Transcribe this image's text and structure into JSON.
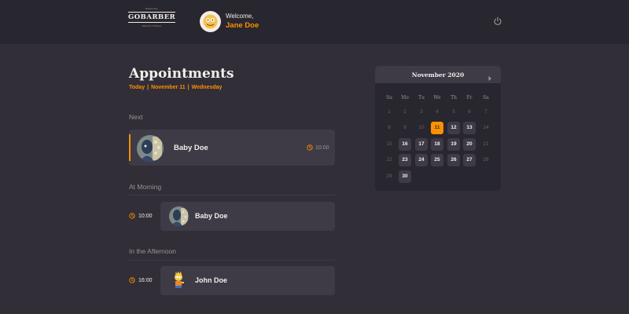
{
  "header": {
    "logo_top_text": "Barbershop",
    "logo_brand": "GOBARBER",
    "logo_bottom_text": "Haircuts & Shaves",
    "welcome_label": "Welcome,",
    "user_name": "Jane Doe"
  },
  "page": {
    "title": "Appointments",
    "date_today": "Today",
    "date_day": "November 11",
    "date_weekday": "Wednesday",
    "date_separator": "|"
  },
  "next": {
    "section_label": "Next",
    "name": "Baby Doe",
    "time": "10:00"
  },
  "morning": {
    "section_label": "At Morning",
    "appointments": [
      {
        "time": "10:00",
        "name": "Baby Doe"
      }
    ]
  },
  "afternoon": {
    "section_label": "In the Afternoon",
    "appointments": [
      {
        "time": "16:00",
        "name": "John Doe"
      }
    ]
  },
  "calendar": {
    "month_label": "November 2020",
    "weekdays": [
      "Su",
      "Mo",
      "Tu",
      "We",
      "Th",
      "Fr",
      "Sa"
    ],
    "weeks": [
      [
        1,
        2,
        3,
        4,
        5,
        6,
        7
      ],
      [
        8,
        9,
        10,
        11,
        12,
        13,
        14
      ],
      [
        15,
        16,
        17,
        18,
        19,
        20,
        21
      ],
      [
        22,
        23,
        24,
        25,
        26,
        27,
        28
      ],
      [
        29,
        30
      ]
    ],
    "selected_day": 11,
    "available_days": [
      12,
      13,
      16,
      17,
      18,
      19,
      20,
      23,
      24,
      25,
      26,
      27,
      30
    ]
  },
  "colors": {
    "accent": "#ff9000",
    "background": "#312e38",
    "header": "#28262e",
    "card": "#3e3b47",
    "muted_text": "#999591"
  },
  "icons": {
    "power": "power-icon",
    "clock": "clock-icon",
    "calendar_next": "chevron-right-icon"
  }
}
